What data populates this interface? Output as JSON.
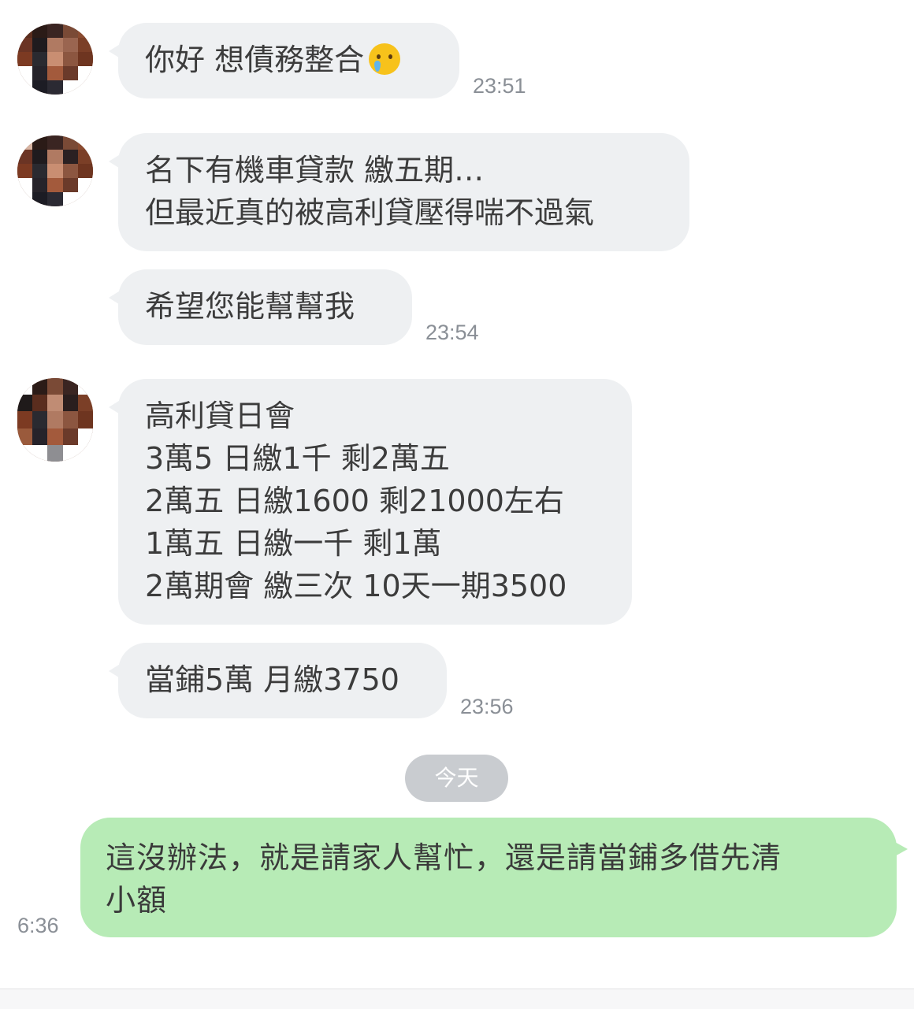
{
  "messages_in": [
    {
      "lines": [
        "你好 想債務整合"
      ],
      "emoji": "crying-face-emoji",
      "time": "23:51"
    },
    {
      "lines": [
        "名下有機車貸款 繳五期…",
        "但最近真的被高利貸壓得喘不過氣"
      ]
    },
    {
      "lines": [
        "希望您能幫幫我"
      ],
      "time": "23:54"
    },
    {
      "lines": [
        "高利貸日會",
        "3萬5 日繳1千 剩2萬五",
        "2萬五 日繳1600 剩21000左右",
        "1萬五 日繳一千 剩1萬",
        "2萬期會 繳三次 10天一期3500"
      ]
    },
    {
      "lines": [
        "當鋪5萬 月繳3750"
      ],
      "time": "23:56"
    }
  ],
  "date_divider": "今天",
  "message_out": {
    "lines": [
      "這沒辦法，就是請家人幫忙，還是請當鋪多借先清",
      "小額"
    ],
    "time": "6:36"
  },
  "colors": {
    "incoming_bubble": "#eef0f2",
    "outgoing_bubble": "#b7ebb6",
    "timestamp": "#8a8f96",
    "date_chip": "#c9ccd0"
  }
}
